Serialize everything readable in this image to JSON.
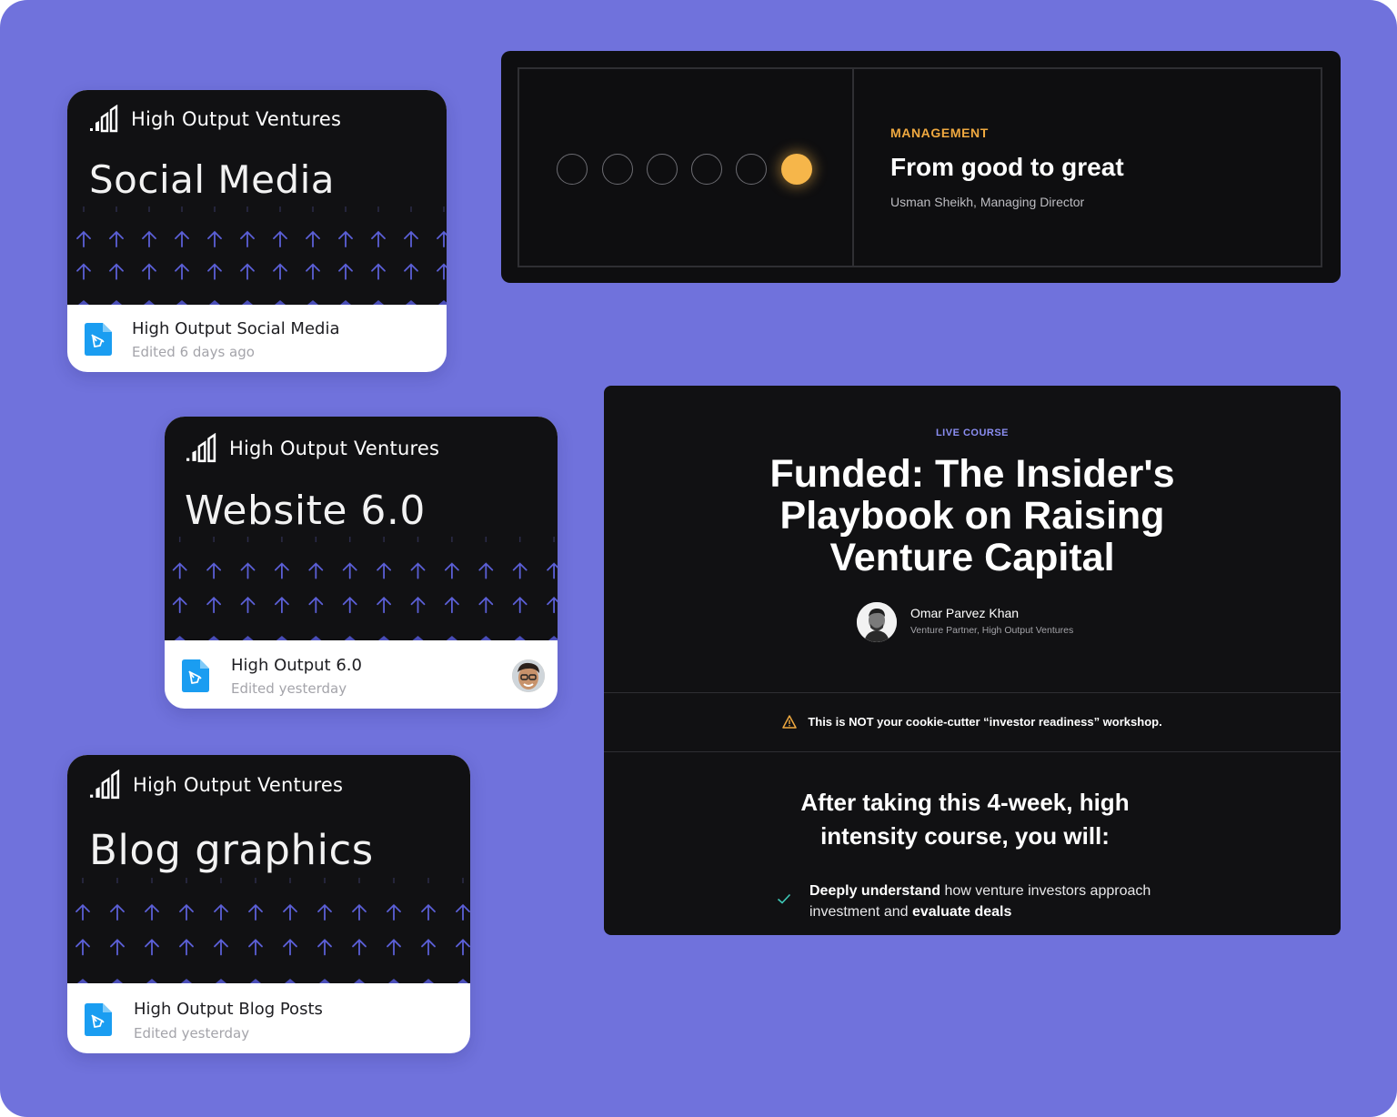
{
  "file_cards": [
    {
      "brand": "High Output Ventures",
      "thumb_title": "Social Media",
      "file_name": "High Output Social Media",
      "edited": "Edited 6 days ago"
    },
    {
      "brand": "High Output Ventures",
      "thumb_title": "Website 6.0",
      "file_name": "High Output 6.0",
      "edited": "Edited yesterday"
    },
    {
      "brand": "High Output Ventures",
      "thumb_title": "Blog graphics",
      "file_name": "High Output Blog Posts",
      "edited": "Edited yesterday"
    }
  ],
  "management_banner": {
    "category": "MANAGEMENT",
    "title": "From good to great",
    "author": "Usman Sheikh, Managing Director",
    "progress": {
      "total": 6,
      "active": 6
    }
  },
  "course": {
    "label": "LIVE COURSE",
    "title_lines": [
      "Funded: The Insider's",
      "Playbook on Raising",
      "Venture Capital"
    ],
    "instructor_name": "Omar Parvez Khan",
    "instructor_role": "Venture Partner, High Output Ventures",
    "warning": "This is NOT your cookie-cutter “investor readiness” workshop.",
    "after_heading_lines": [
      "After taking this 4-week, high",
      "intensity course, you will:"
    ],
    "outcome": {
      "bold1": "Deeply understand",
      "text1": " how venture investors approach investment and ",
      "bold2": "evaluate deals"
    }
  },
  "colors": {
    "background": "#7072dc",
    "card_dark": "#111113",
    "accent_orange": "#f6b64a",
    "accent_purple": "#8b8ef2",
    "check_teal": "#3ec9b7",
    "doc_blue": "#1a9df1"
  }
}
